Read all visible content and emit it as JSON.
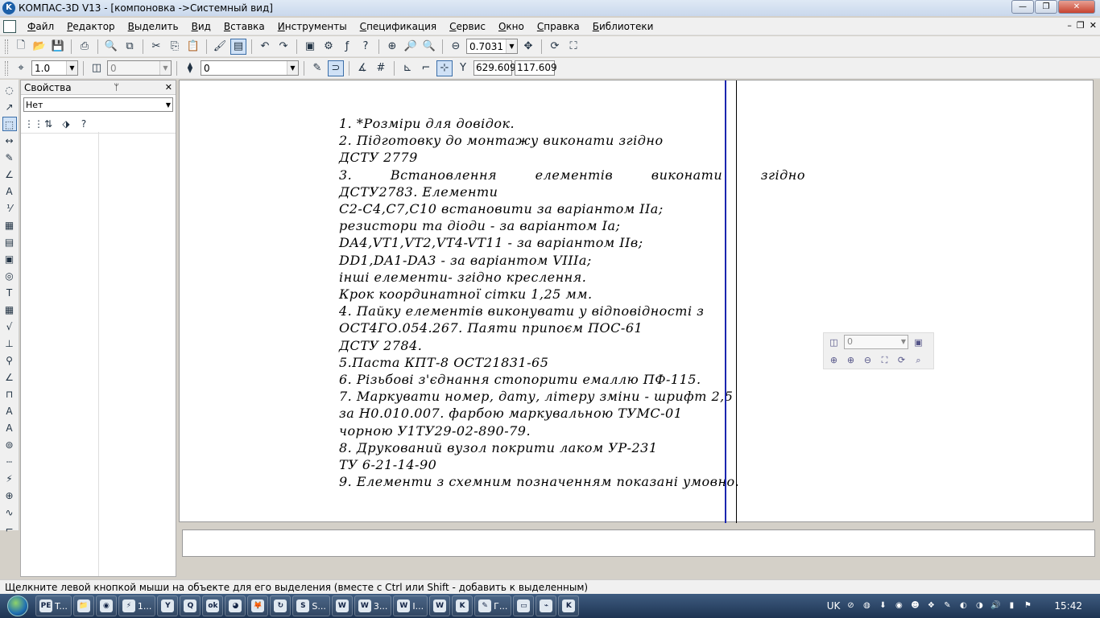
{
  "window": {
    "title": "КОМПАС-3D V13 - [компоновка ->Системный вид]",
    "app_icon": "K"
  },
  "window_buttons": {
    "minimize": "—",
    "maximize": "❐",
    "close": "✕"
  },
  "menu": {
    "items": [
      "Файл",
      "Редактор",
      "Выделить",
      "Вид",
      "Вставка",
      "Инструменты",
      "Спецификация",
      "Сервис",
      "Окно",
      "Справка",
      "Библиотеки"
    ],
    "mdi": {
      "minimize": "–",
      "restore": "❐",
      "close": "✕"
    }
  },
  "toolbar1": {
    "zoom_value": "0.7031"
  },
  "toolbar2": {
    "step_value": "1.0",
    "layer_value": "0",
    "style_value": "0",
    "coord_label": "Y",
    "coord_x": "629.609",
    "coord_y": "117.609"
  },
  "properties_panel": {
    "title": "Свойства",
    "pin": "ᛘ",
    "close": "✕",
    "combo_value": "Нет"
  },
  "drawing": {
    "notes": [
      "1. *Розміри для довідок.",
      "2. Підготовку до монтажу виконати згідно",
      "ДСТУ 2779",
      "3. Встановлення елементів виконати згідно",
      "ДСТУ2783. Елементи",
      "С2-С4,С7,С10 встановити за варіантом IIа;",
      "резистори та діоди - за варіантом Iа;",
      "DA4,VT1,VT2,VT4-VT11 - за варіантом IIв;",
      "DD1,DA1-DA3 - за варіантом VIIIа;",
      "інші елементи- згідно креслення.",
      "Крок координатної сітки 1,25 мм.",
      "4. Пайку елементів виконувати у відповідності з",
      "ОСТ4ГО.054.267. Паяти припоєм ПОС-61",
      "ДСТУ 2784.",
      "5.Паста КПТ-8 ОСТ21831-65",
      "6. Різьбові з'єднання стопорити емаллю ПФ-115.",
      "7. Маркувати номер, дату, літеру зміни - шрифт 2,5",
      "за Н0.010.007. фарбою маркувальною ТУМС-01",
      "чорною У1ТУ29-02-890-79.",
      "8. Друкований вузол покрити лаком УР-231",
      "ТУ 6-21-14-90",
      "9. Елементи з схемним позначенням показані умовно."
    ]
  },
  "float_toolbar": {
    "layer_value": "0"
  },
  "status": {
    "text": "Щелкните левой кнопкой мыши на объекте для его выделения (вместе с Ctrl или Shift - добавить к выделенным)"
  },
  "taskbar": {
    "items": [
      {
        "label": "T...",
        "icon": "PE"
      },
      {
        "label": "",
        "icon": "📁"
      },
      {
        "label": "",
        "icon": "◉"
      },
      {
        "label": "1...",
        "icon": "⚡"
      },
      {
        "label": "",
        "icon": "Y"
      },
      {
        "label": "",
        "icon": "Q"
      },
      {
        "label": "",
        "icon": "ok"
      },
      {
        "label": "",
        "icon": "◕"
      },
      {
        "label": "",
        "icon": "🦊"
      },
      {
        "label": "",
        "icon": "↻"
      },
      {
        "label": "S...",
        "icon": "S"
      },
      {
        "label": "",
        "icon": "W"
      },
      {
        "label": "3...",
        "icon": "W"
      },
      {
        "label": "I...",
        "icon": "W"
      },
      {
        "label": "",
        "icon": "W"
      },
      {
        "label": "",
        "icon": "K"
      },
      {
        "label": "Г...",
        "icon": "✎"
      },
      {
        "label": "",
        "icon": "▭"
      },
      {
        "label": "",
        "icon": "⌁"
      },
      {
        "label": "",
        "icon": "K"
      }
    ],
    "lang": "UK",
    "clock": "15:42"
  }
}
